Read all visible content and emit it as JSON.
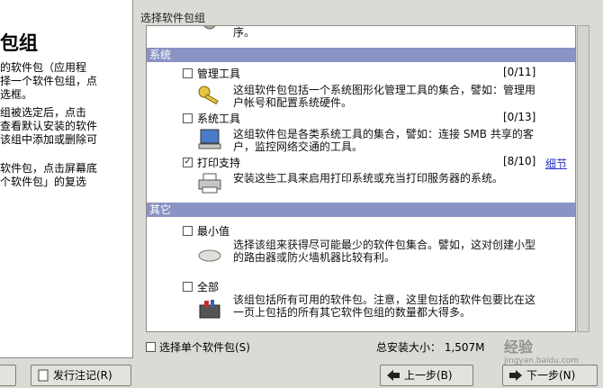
{
  "help": {
    "title": "包组",
    "paragraphs": [
      [
        "的软件包（应用程",
        "择一个软件包组，点",
        "选框。"
      ],
      [
        "组被选定后，点击",
        "查看默认安装的软件",
        "该组中添加或删除可"
      ],
      [
        "软件包，点击屏幕底",
        "个软件包」的复选"
      ]
    ]
  },
  "frame_label": "选择软件包组",
  "top_partial_text": "序。",
  "categories": [
    {
      "label": "系统"
    },
    {
      "label": "其它"
    }
  ],
  "groups": [
    {
      "name": "管理工具",
      "count": "[0/11]",
      "checked": false,
      "icon": "keys-icon",
      "desc": "这组软件包包括一个系统图形化管理工具的集合，譬如：管理用户帐号和配置系统硬件。"
    },
    {
      "name": "系统工具",
      "count": "[0/13]",
      "checked": false,
      "icon": "monitor-icon",
      "desc": "这组软件包是各类系统工具的集合，譬如：连接 SMB 共享的客户，监控网络交通的工具。"
    },
    {
      "name": "打印支持",
      "count": "[8/10]",
      "checked": true,
      "icon": "printer-icon",
      "desc": "安装这些工具来启用打印系统或充当打印服务器的系统。"
    },
    {
      "name": "最小值",
      "count": "",
      "checked": false,
      "icon": "router-icon",
      "desc": "选择该组来获得尽可能最少的软件包集合。譬如，这对创建小型的路由器或防火墙机器比较有利。"
    },
    {
      "name": "全部",
      "count": "",
      "checked": false,
      "icon": "toolbox-icon",
      "desc": "该组包括所有可用的软件包。注意，这里包括的软件包要比在这一页上包括的所有其它软件包组的数量都大得多。"
    }
  ],
  "details_link": "细节",
  "individual_label": "选择单个软件包(S)",
  "total_label": "总安装大小： 1,507M",
  "watermark": {
    "text": "经验",
    "sub": "jingyan.baidu.com"
  },
  "buttons": {
    "release_notes": "发行注记(R)",
    "back": "上一步(B)",
    "next": "下一步(N)"
  }
}
